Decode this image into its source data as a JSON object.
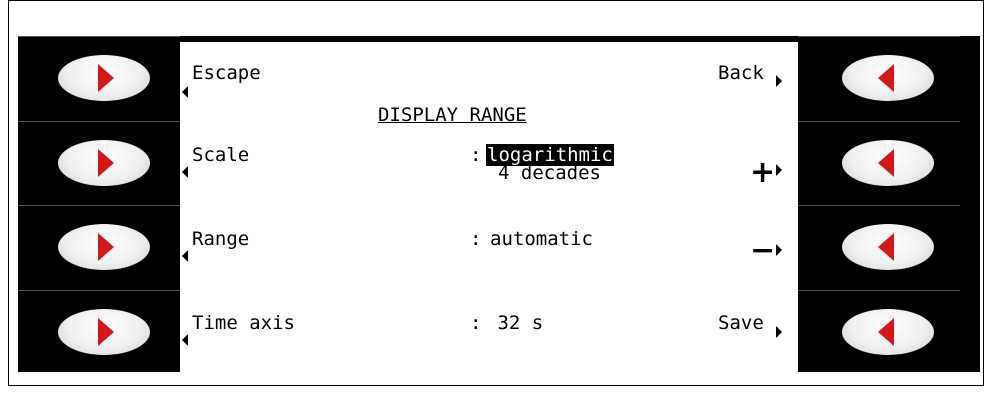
{
  "screen": {
    "title": "DISPLAY RANGE",
    "softkeys": {
      "left": [
        "Escape",
        "",
        "",
        ""
      ],
      "right": [
        "Back",
        "+",
        "−",
        "Save"
      ]
    },
    "rows": [
      {
        "label": "Scale",
        "sep": ":",
        "value": "logarithmic",
        "value2": "4 decades"
      },
      {
        "label": "Range",
        "sep": ":",
        "value": "automatic"
      },
      {
        "label": "Time axis",
        "sep": ":",
        "value": " 32 s"
      }
    ]
  },
  "colors": {
    "panel": "#000000",
    "screen": "#ffffff",
    "arrow": "#d21818",
    "button": "#f0f0f0"
  },
  "icons": {
    "left_buttons": "red-right-triangle",
    "right_buttons": "red-left-triangle"
  }
}
